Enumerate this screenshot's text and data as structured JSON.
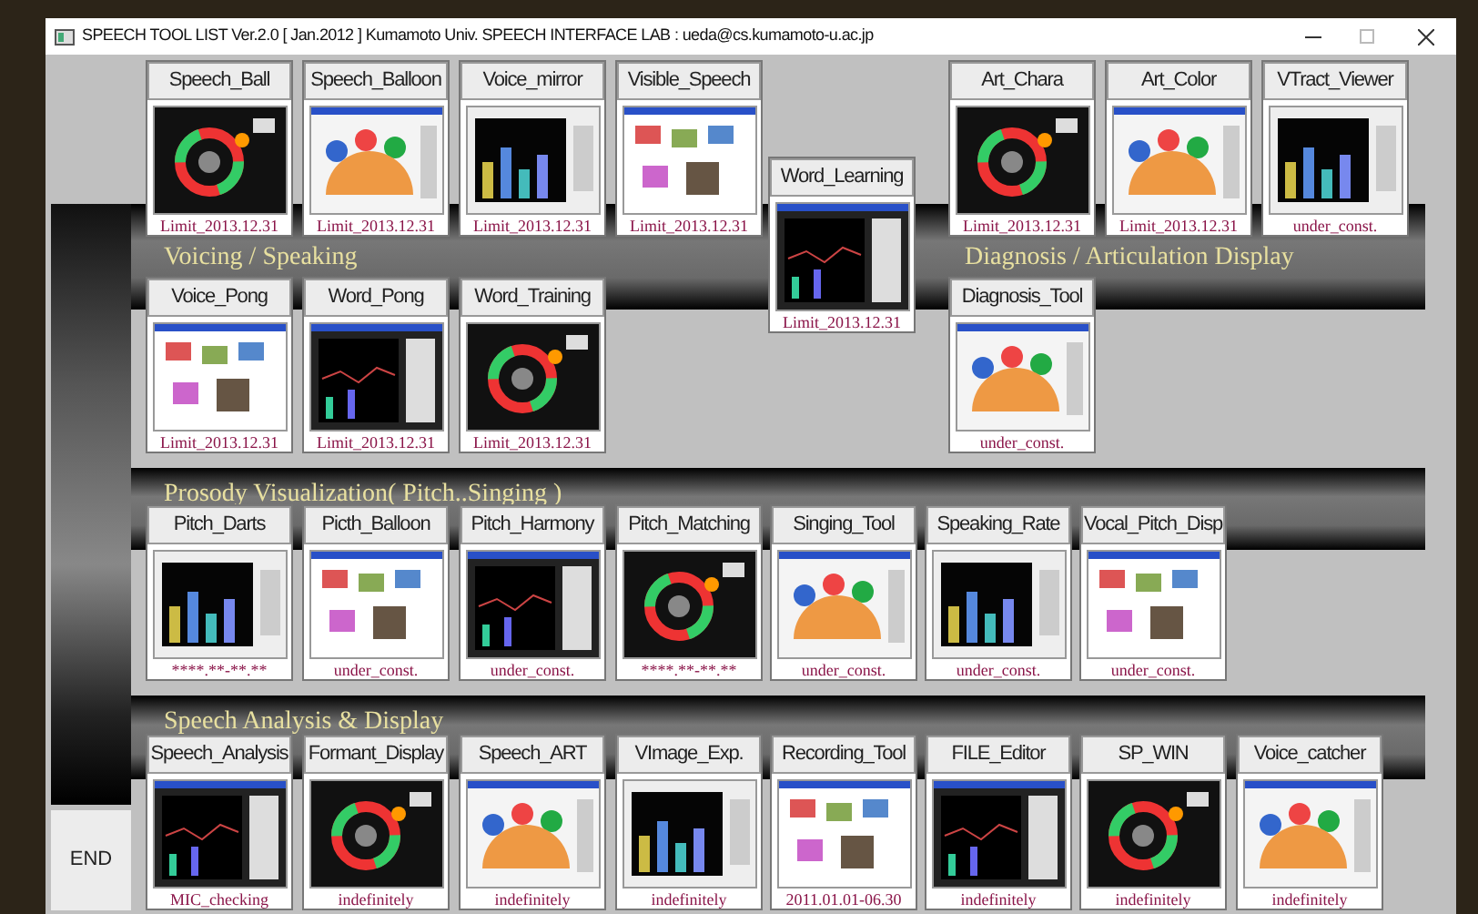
{
  "window": {
    "title": "SPEECH TOOL LIST Ver.2.0  [ Jan.2012 ] Kumamoto Univ. SPEECH INTERFACE LAB : ueda@cs.kumamoto-u.ac.jp"
  },
  "sections": [
    {
      "title": "Voicing / Speaking"
    },
    {
      "title": "Diagnosis / Articulation Display"
    },
    {
      "title": "Prosody Visualization( Pitch..Singing )"
    },
    {
      "title": "Speech Analysis & Display"
    }
  ],
  "tiles": [
    {
      "name": "Speech_Ball",
      "note": "Limit_2013.12.31"
    },
    {
      "name": "Speech_Balloon",
      "note": "Limit_2013.12.31"
    },
    {
      "name": "Voice_mirror",
      "note": "Limit_2013.12.31"
    },
    {
      "name": "Visible_Speech",
      "note": "Limit_2013.12.31"
    },
    {
      "name": "Word_Learning",
      "note": "Limit_2013.12.31"
    },
    {
      "name": "Art_Chara",
      "note": "Limit_2013.12.31"
    },
    {
      "name": "Art_Color",
      "note": "Limit_2013.12.31"
    },
    {
      "name": "VTract_Viewer",
      "note": "under_const."
    },
    {
      "name": "Voice_Pong",
      "note": "Limit_2013.12.31"
    },
    {
      "name": "Word_Pong",
      "note": "Limit_2013.12.31"
    },
    {
      "name": "Word_Training",
      "note": "Limit_2013.12.31"
    },
    {
      "name": "Diagnosis_Tool",
      "note": "under_const."
    },
    {
      "name": "Pitch_Darts",
      "note": "****.**-**.**"
    },
    {
      "name": "Picth_Balloon",
      "note": "under_const."
    },
    {
      "name": "Pitch_Harmony",
      "note": "under_const."
    },
    {
      "name": "Pitch_Matching",
      "note": "****.**-**.**"
    },
    {
      "name": "Singing_Tool",
      "note": "under_const."
    },
    {
      "name": "Speaking_Rate",
      "note": "under_const."
    },
    {
      "name": "Vocal_Pitch_Disp",
      "note": "under_const."
    },
    {
      "name": "Speech_Analysis",
      "note": "MIC_checking"
    },
    {
      "name": "Formant_Display",
      "note": "indefinitely"
    },
    {
      "name": "Speech_ART",
      "note": "indefinitely"
    },
    {
      "name": "VImage_Exp.",
      "note": "indefinitely"
    },
    {
      "name": "Recording_Tool",
      "note": "2011.01.01-06.30"
    },
    {
      "name": "FILE_Editor",
      "note": "indefinitely"
    },
    {
      "name": "SP_WIN",
      "note": "indefinitely"
    },
    {
      "name": "Voice_catcher",
      "note": "indefinitely"
    }
  ],
  "end_button": "END"
}
